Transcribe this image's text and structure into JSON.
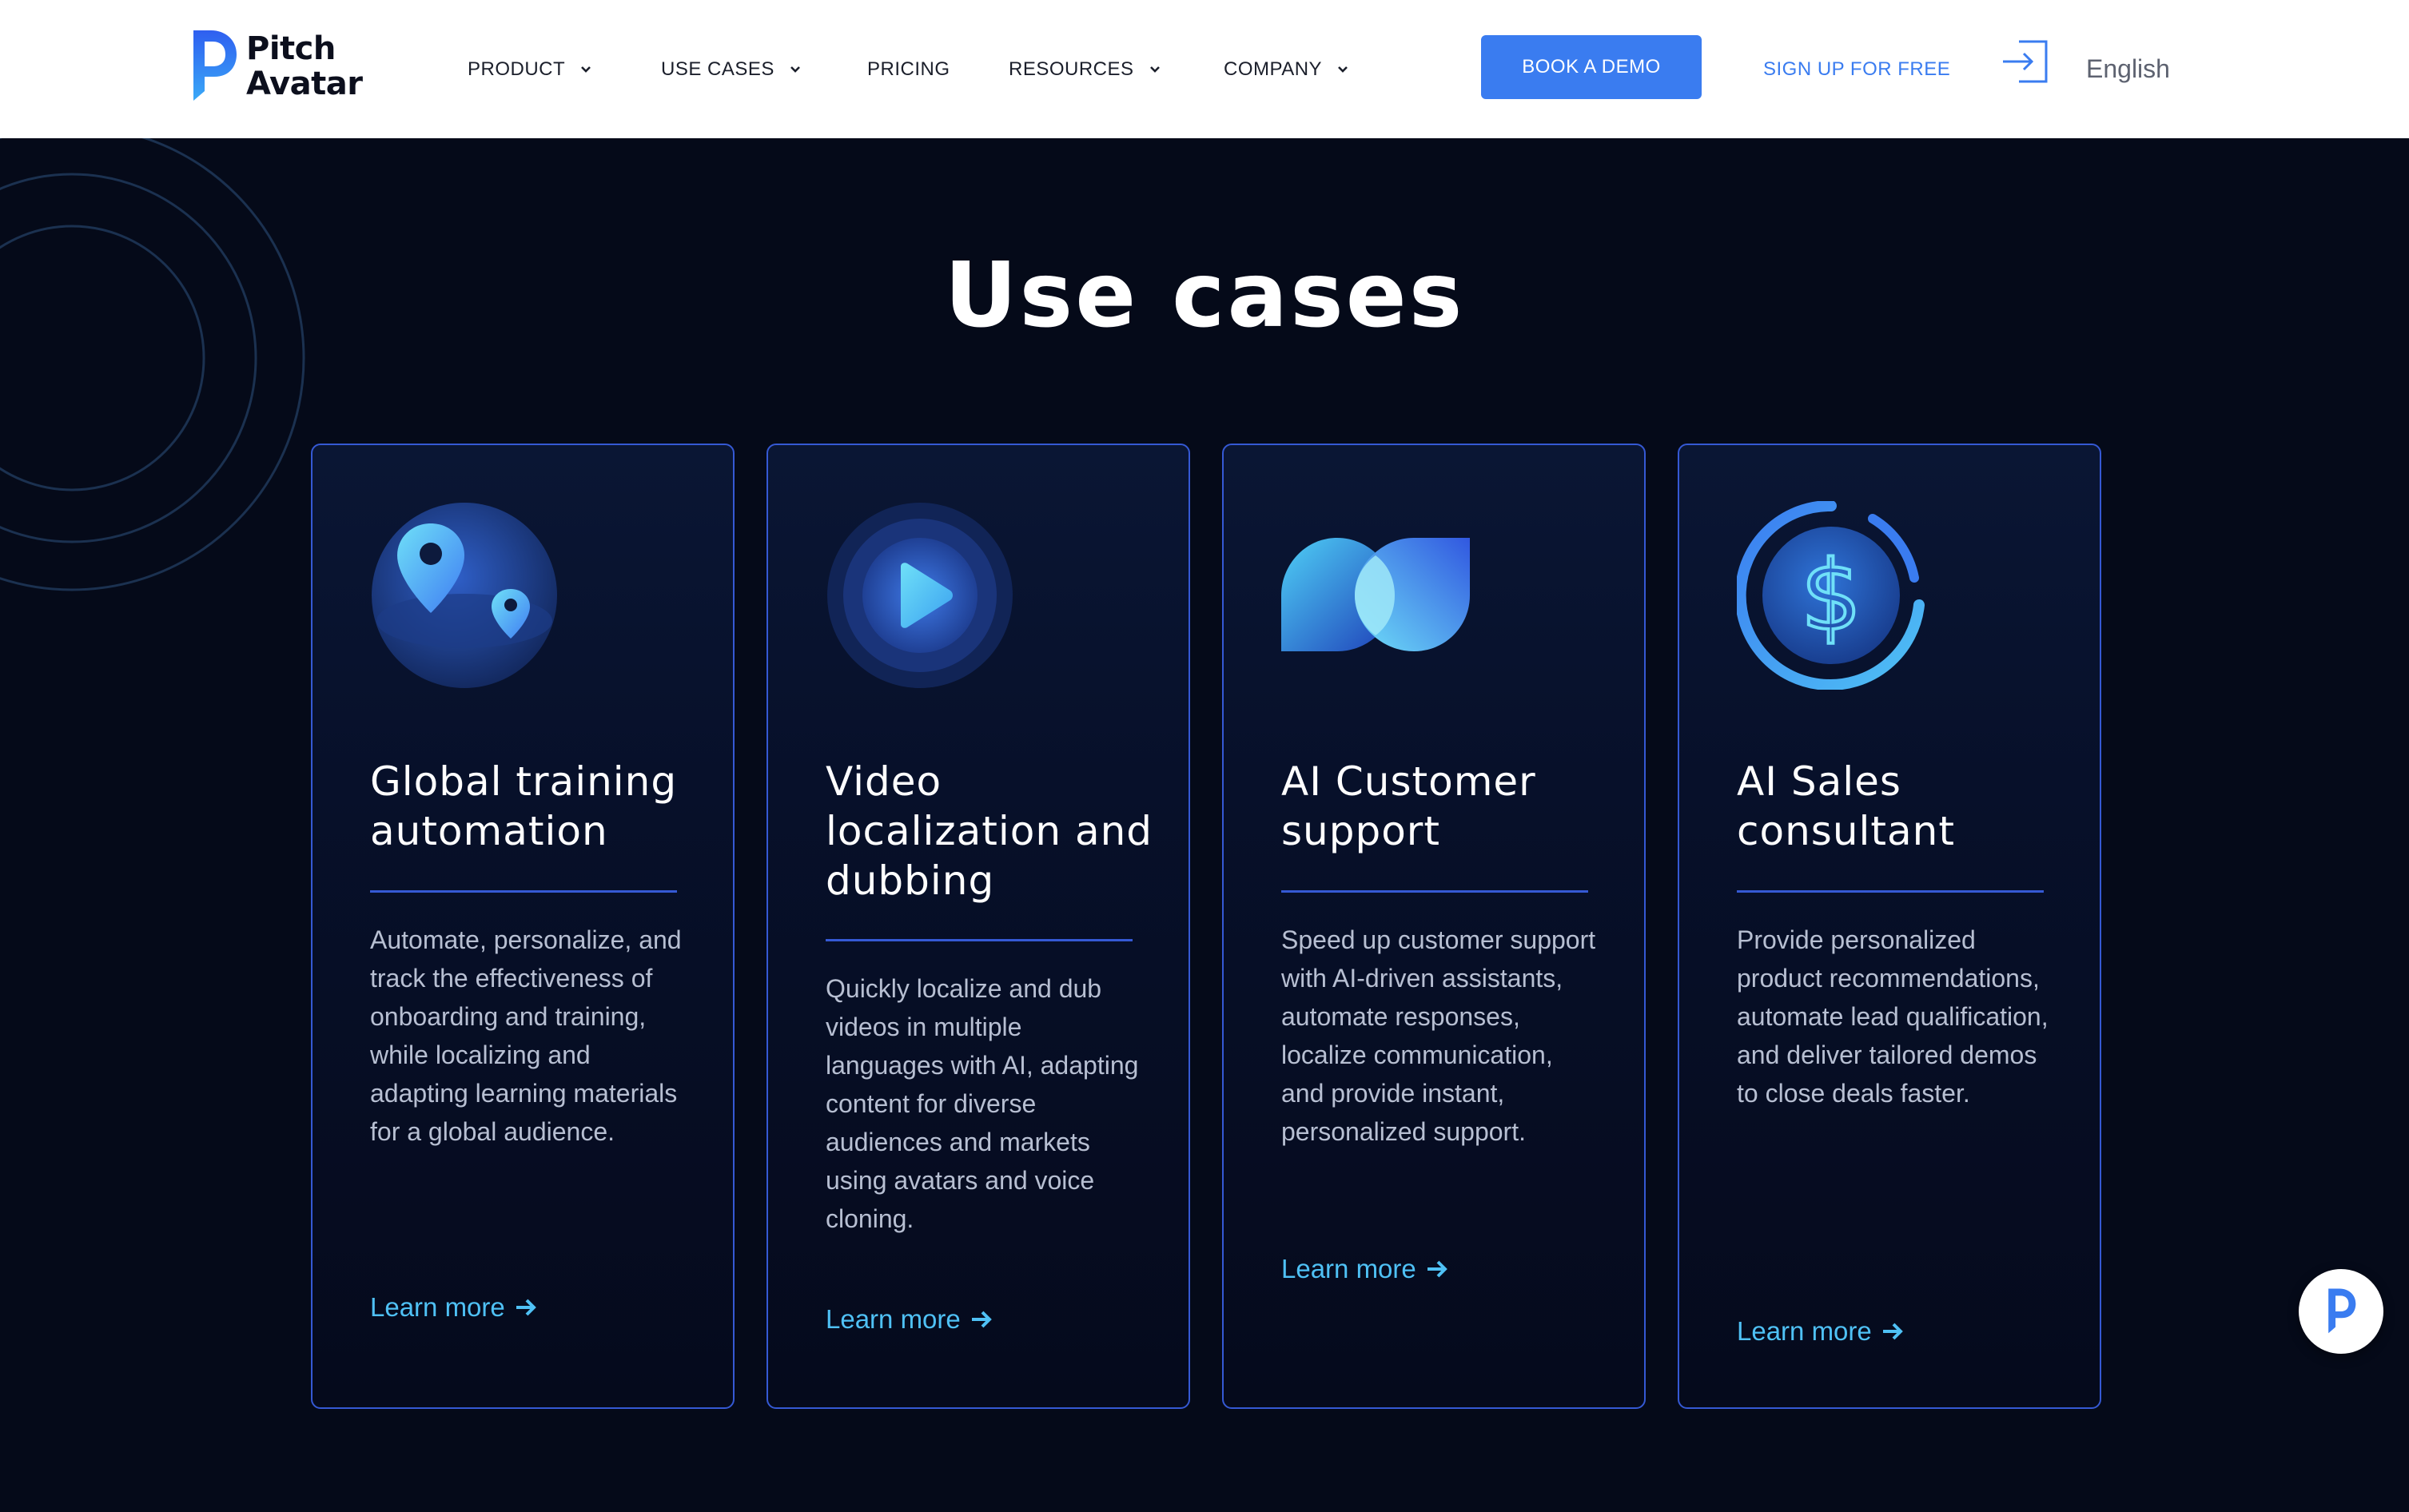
{
  "header": {
    "logo": {
      "line1": "Pitch",
      "line2": "Avatar"
    },
    "nav": [
      {
        "label": "PRODUCT",
        "has_dropdown": true
      },
      {
        "label": "USE CASES",
        "has_dropdown": true
      },
      {
        "label": "PRICING",
        "has_dropdown": false
      },
      {
        "label": "RESOURCES",
        "has_dropdown": true
      },
      {
        "label": "COMPANY",
        "has_dropdown": true
      }
    ],
    "book_demo_label": "BOOK A DEMO",
    "signup_label": "SIGN UP FOR FREE",
    "language": "English"
  },
  "main": {
    "title": "Use cases",
    "cards": [
      {
        "icon": "map-pin-globe-icon",
        "title": "Global training automation",
        "description": "Automate, personalize, and track the effectiveness of onboarding and training, while localizing and adapting learning materials for a global audience.",
        "link": "Learn more"
      },
      {
        "icon": "video-play-icon",
        "title": "Video localization and dubbing",
        "description": "Quickly localize and dub videos in multiple languages with AI, adapting content for diverse audiences and markets using avatars and voice cloning.",
        "link": "Learn more"
      },
      {
        "icon": "speech-bubbles-icon",
        "title": "AI Customer support",
        "description": "Speed up customer support with AI-driven assistants, automate responses, localize communication, and provide instant, personalized support.",
        "link": "Learn more"
      },
      {
        "icon": "dollar-coin-icon",
        "title": "AI Sales consultant",
        "description": "Provide personalized product recommendations, automate lead qualification, and deliver tailored demos to close deals faster.",
        "link": "Learn more"
      }
    ]
  },
  "colors": {
    "accent": "#3a7cf0",
    "background": "#050a19",
    "card_border": "#3559d4",
    "link": "#4fc1f5"
  }
}
